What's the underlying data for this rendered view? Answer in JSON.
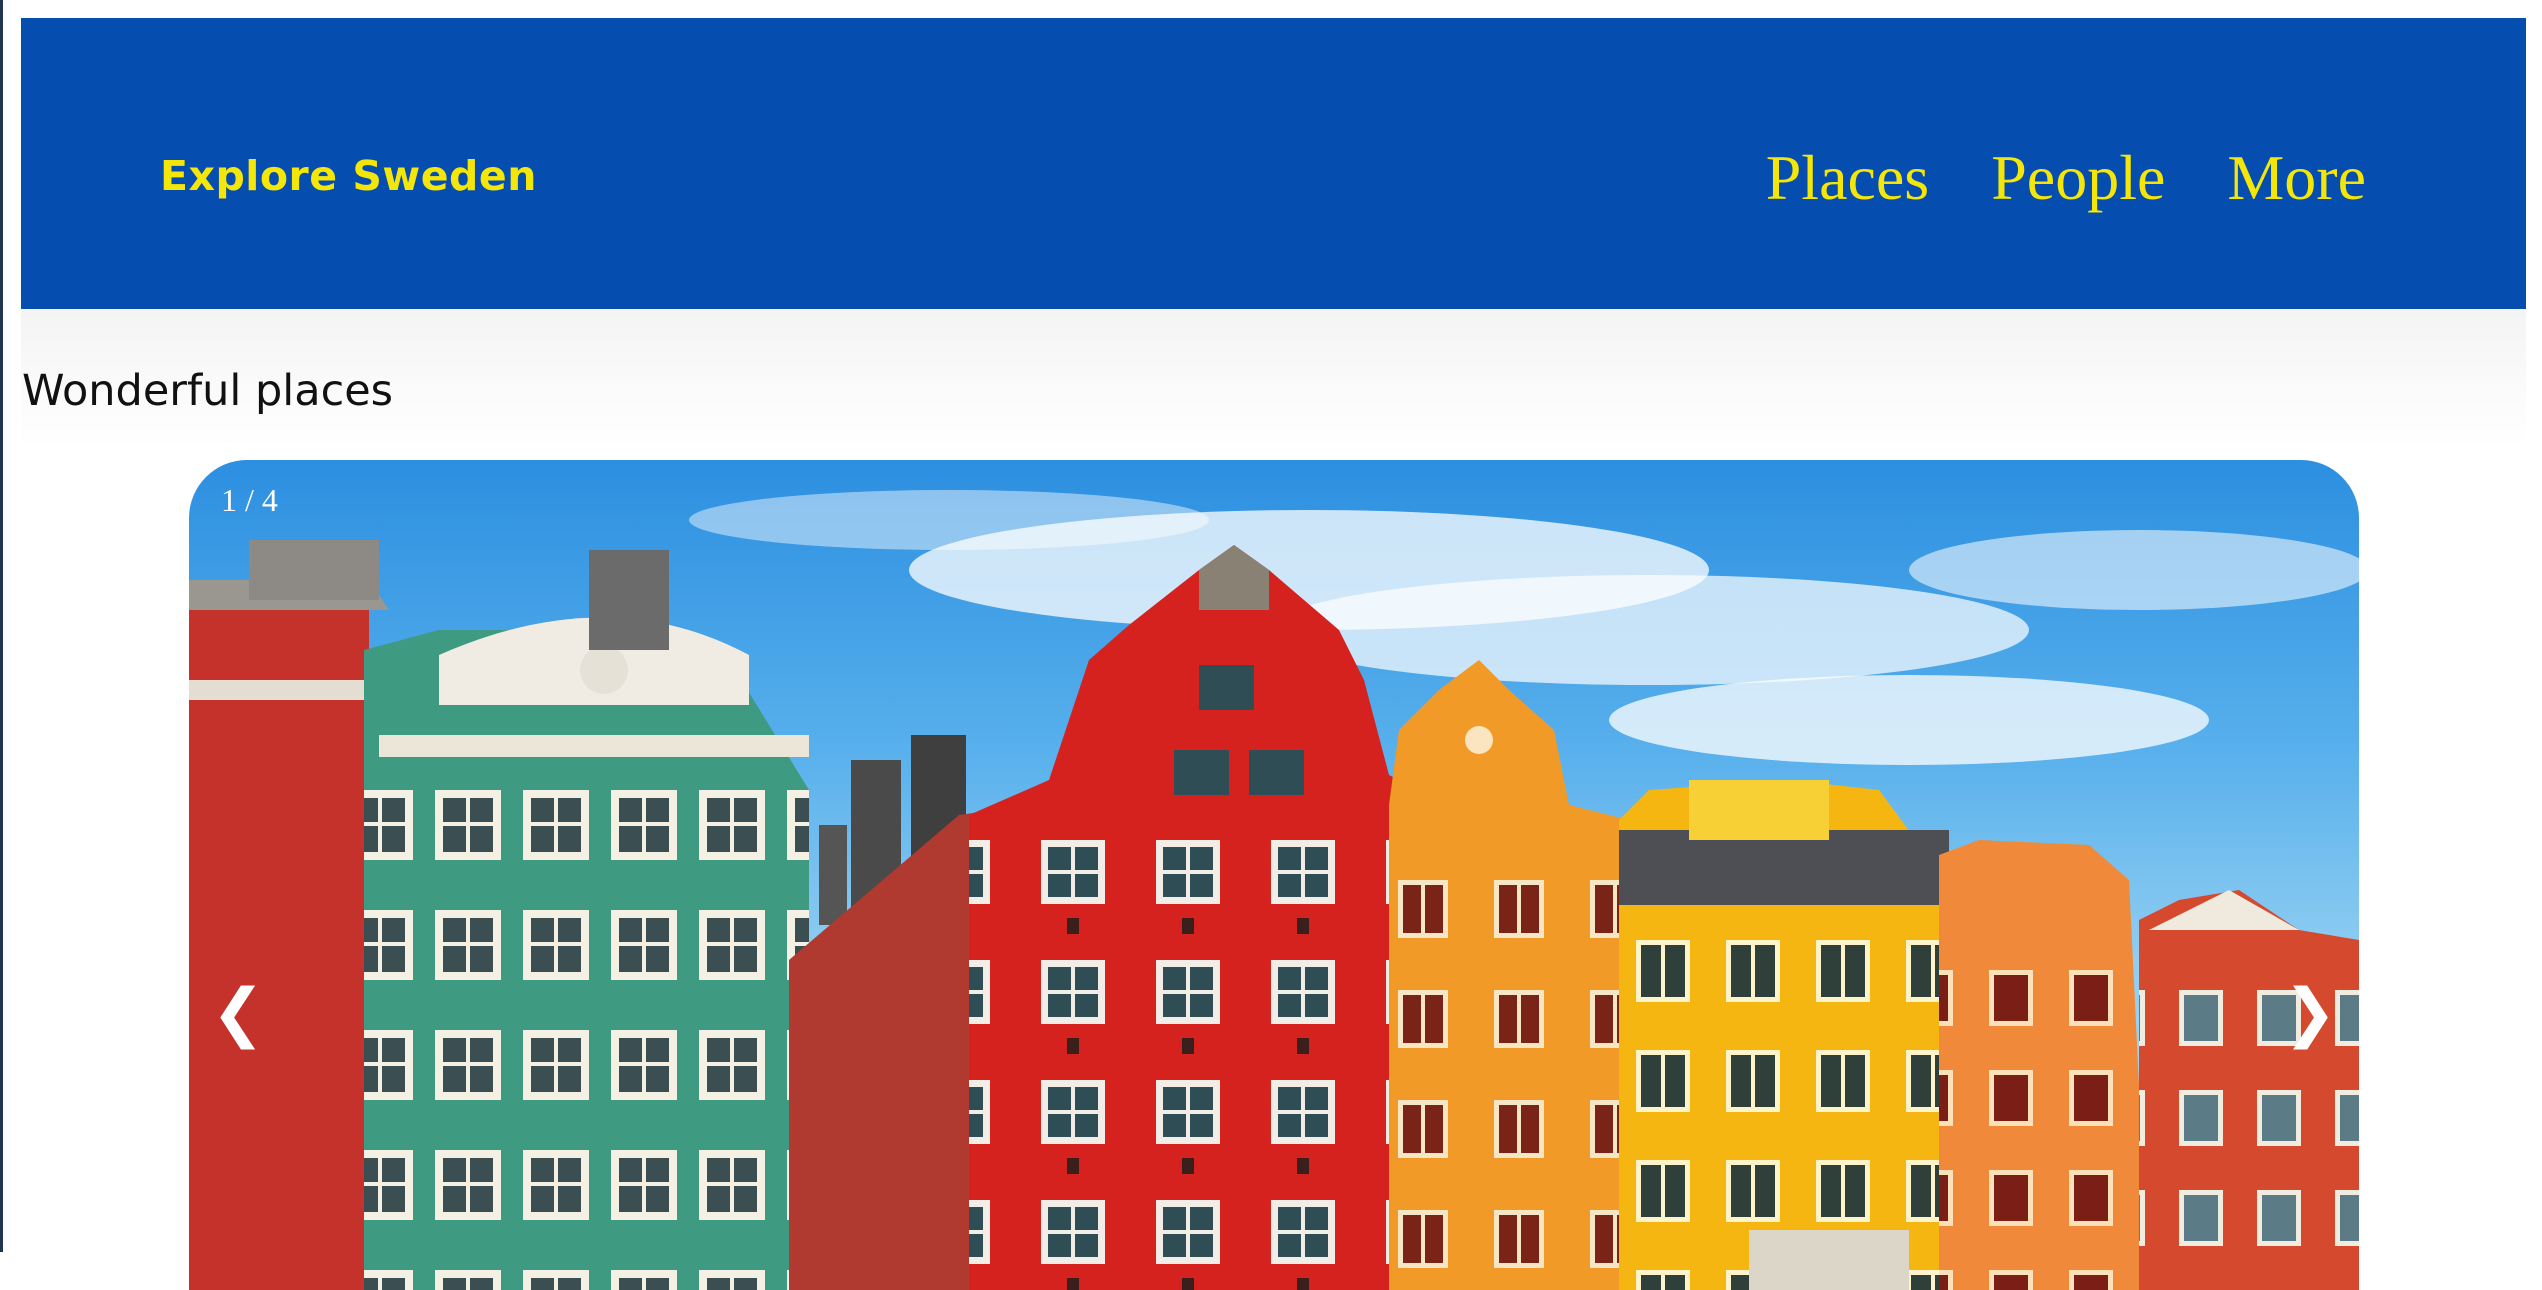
{
  "header": {
    "brand": "Explore Sweden",
    "nav": [
      "Places",
      "People",
      "More"
    ]
  },
  "colors": {
    "header_bg": "#054eb0",
    "accent_yellow": "#f5e60a"
  },
  "main": {
    "section_title": "Wonderful places",
    "slideshow": {
      "counter": "1 / 4",
      "current_slide": 1,
      "total_slides": 4,
      "prev_icon": "❮",
      "next_icon": "❯",
      "image": "colorful-gabled-buildings-stockholm-old-town"
    }
  }
}
